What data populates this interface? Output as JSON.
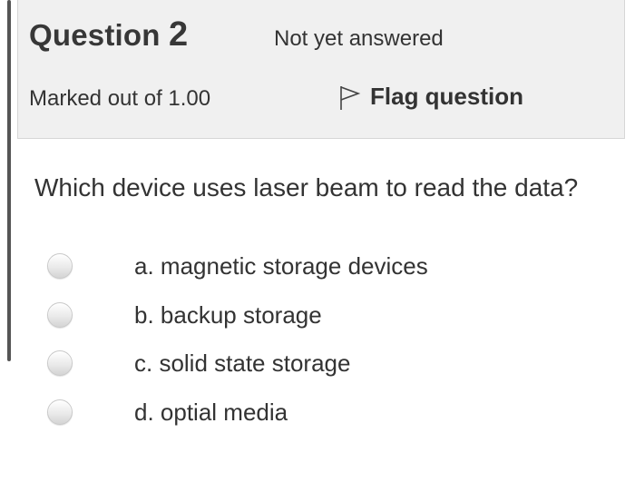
{
  "header": {
    "question_word": "Question",
    "question_number": "2",
    "state": "Not yet answered",
    "grade": "Marked out of 1.00",
    "flag_label": "Flag question",
    "flag_icon": "flag-outline-icon"
  },
  "question": {
    "text": "Which device uses laser beam to read the data?"
  },
  "answers": [
    {
      "label": "a. magnetic storage devices",
      "selected": false
    },
    {
      "label": "b. backup storage",
      "selected": false
    },
    {
      "label": "c. solid state storage",
      "selected": false
    },
    {
      "label": "d. optial media",
      "selected": false
    }
  ],
  "colors": {
    "info_background": "#f0f0f0",
    "info_border": "#d6d6d6",
    "text": "#333333",
    "left_rule": "#555555"
  }
}
